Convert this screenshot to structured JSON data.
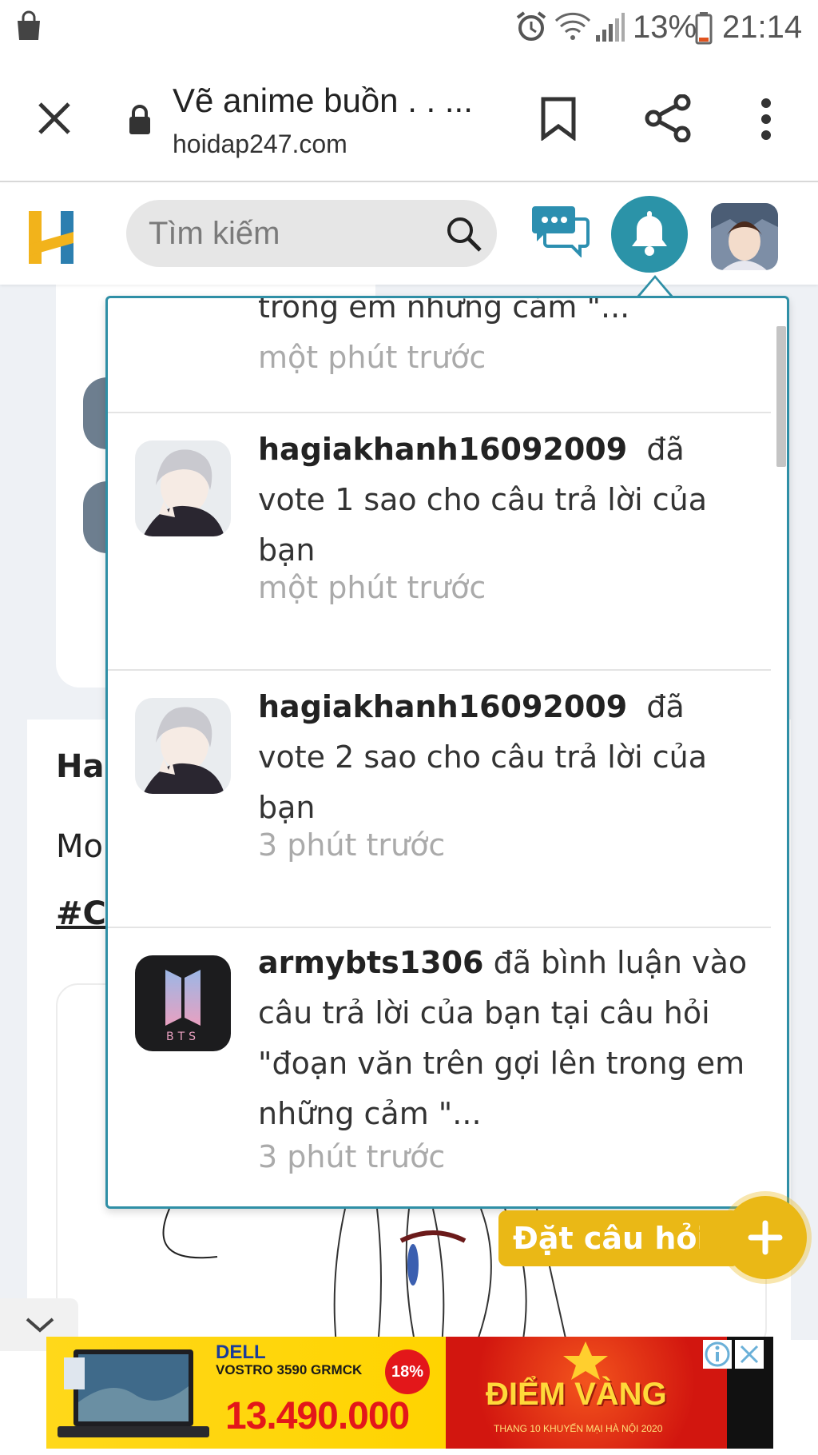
{
  "status_bar": {
    "battery": "13%",
    "time": "21:14",
    "icons": [
      "shopping-bag-icon",
      "alarm-icon",
      "wifi-icon",
      "signal-icon",
      "battery-icon"
    ]
  },
  "browser": {
    "tab_title": "Vẽ anime buồn . . ...",
    "url": "hoidap247.com",
    "icons": [
      "close-icon",
      "lock-icon",
      "bookmark-icon",
      "share-icon",
      "more-vertical-icon"
    ]
  },
  "site_header": {
    "logo_letter": "H",
    "search_placeholder": "Tìm kiếm",
    "icons": [
      "search-icon",
      "chat-icon",
      "bell-icon",
      "avatar"
    ]
  },
  "background": {
    "author_partial": "Ha",
    "text_partial": "Mo",
    "hashtag_partial": "#Cl"
  },
  "notifications": {
    "items": [
      {
        "username": "",
        "text": "trong em những cảm \"...",
        "time": "một phút trước"
      },
      {
        "username": "hagiakhanh16092009",
        "text": "đã vote 1 sao cho câu trả lời của bạn",
        "time": "một phút trước"
      },
      {
        "username": "hagiakhanh16092009",
        "text": "đã vote 2 sao cho câu trả lời của bạn",
        "time": "3 phút trước"
      },
      {
        "username": "armybts1306",
        "text": "đã bình luận vào câu trả lời của bạn tại câu hỏi \"đoạn văn trên gợi lên trong em những cảm \"...",
        "time": "3 phút trước"
      }
    ],
    "bts_logo_text": "BTS"
  },
  "ask_button": {
    "label": "Đặt câu hỏi",
    "plus": "+"
  },
  "ad": {
    "brand": "DELL",
    "model": "VOSTRO 3590 GRMCK",
    "discount": "18%",
    "price": "13.490.000",
    "promo": "ĐIỂM VÀNG",
    "promo_sub": "THANG 10 KHUYẾN MẠI HÀ NỘI 2020",
    "info_icon": "info-icon",
    "close_icon": "close-icon"
  },
  "colors": {
    "accent_teal": "#2f8fa6",
    "bell_bg": "#2b93a8",
    "ask_yellow": "#eab816",
    "logo_yellow": "#f2b31b",
    "logo_blue": "#2c7fb0"
  }
}
